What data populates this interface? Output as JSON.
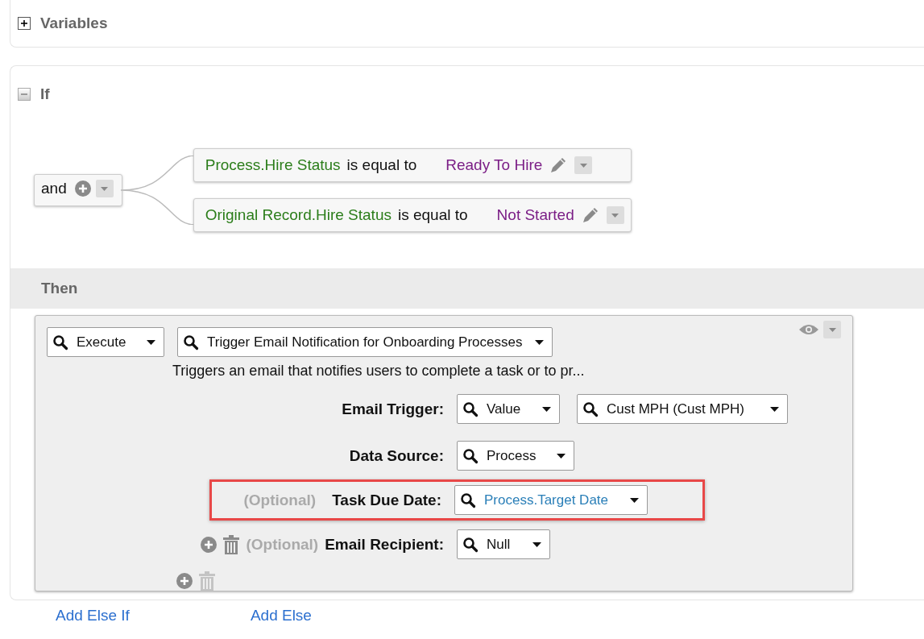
{
  "variables": {
    "label": "Variables",
    "expanded": false
  },
  "if_section": {
    "label": "If",
    "expanded": true,
    "operator": "and",
    "conditions": [
      {
        "field": "Process.Hire Status",
        "operator": "is equal to",
        "value": "Ready To Hire"
      },
      {
        "field": "Original Record.Hire Status",
        "operator": "is equal to",
        "value": "Not Started"
      }
    ]
  },
  "then_section": {
    "label": "Then",
    "action": {
      "select": "Execute",
      "function": "Trigger Email Notification for Onboarding Processes",
      "description": "Triggers an email that notifies users to complete a task or to pr...",
      "params": [
        {
          "label": "Email Trigger:",
          "highlighted": false,
          "removable": false,
          "dropdowns": [
            {
              "value": "Value",
              "kind": "plain"
            },
            {
              "value": "Cust MPH (Cust MPH)",
              "kind": "plain"
            }
          ]
        },
        {
          "label": "Data Source:",
          "highlighted": false,
          "removable": false,
          "dropdowns": [
            {
              "value": "Process",
              "kind": "plain"
            }
          ]
        },
        {
          "label": "Task Due Date:",
          "optional_label": "(Optional)",
          "highlighted": true,
          "removable": false,
          "dropdowns": [
            {
              "value": "Process.Target Date",
              "kind": "field"
            }
          ]
        },
        {
          "label": "Email Recipient:",
          "optional_label": "(Optional)",
          "highlighted": false,
          "removable": true,
          "dropdowns": [
            {
              "value": "Null",
              "kind": "plain"
            }
          ]
        }
      ],
      "footer": {
        "delete_disabled": true
      }
    }
  },
  "links": [
    "Add Else If",
    "Add Else"
  ]
}
